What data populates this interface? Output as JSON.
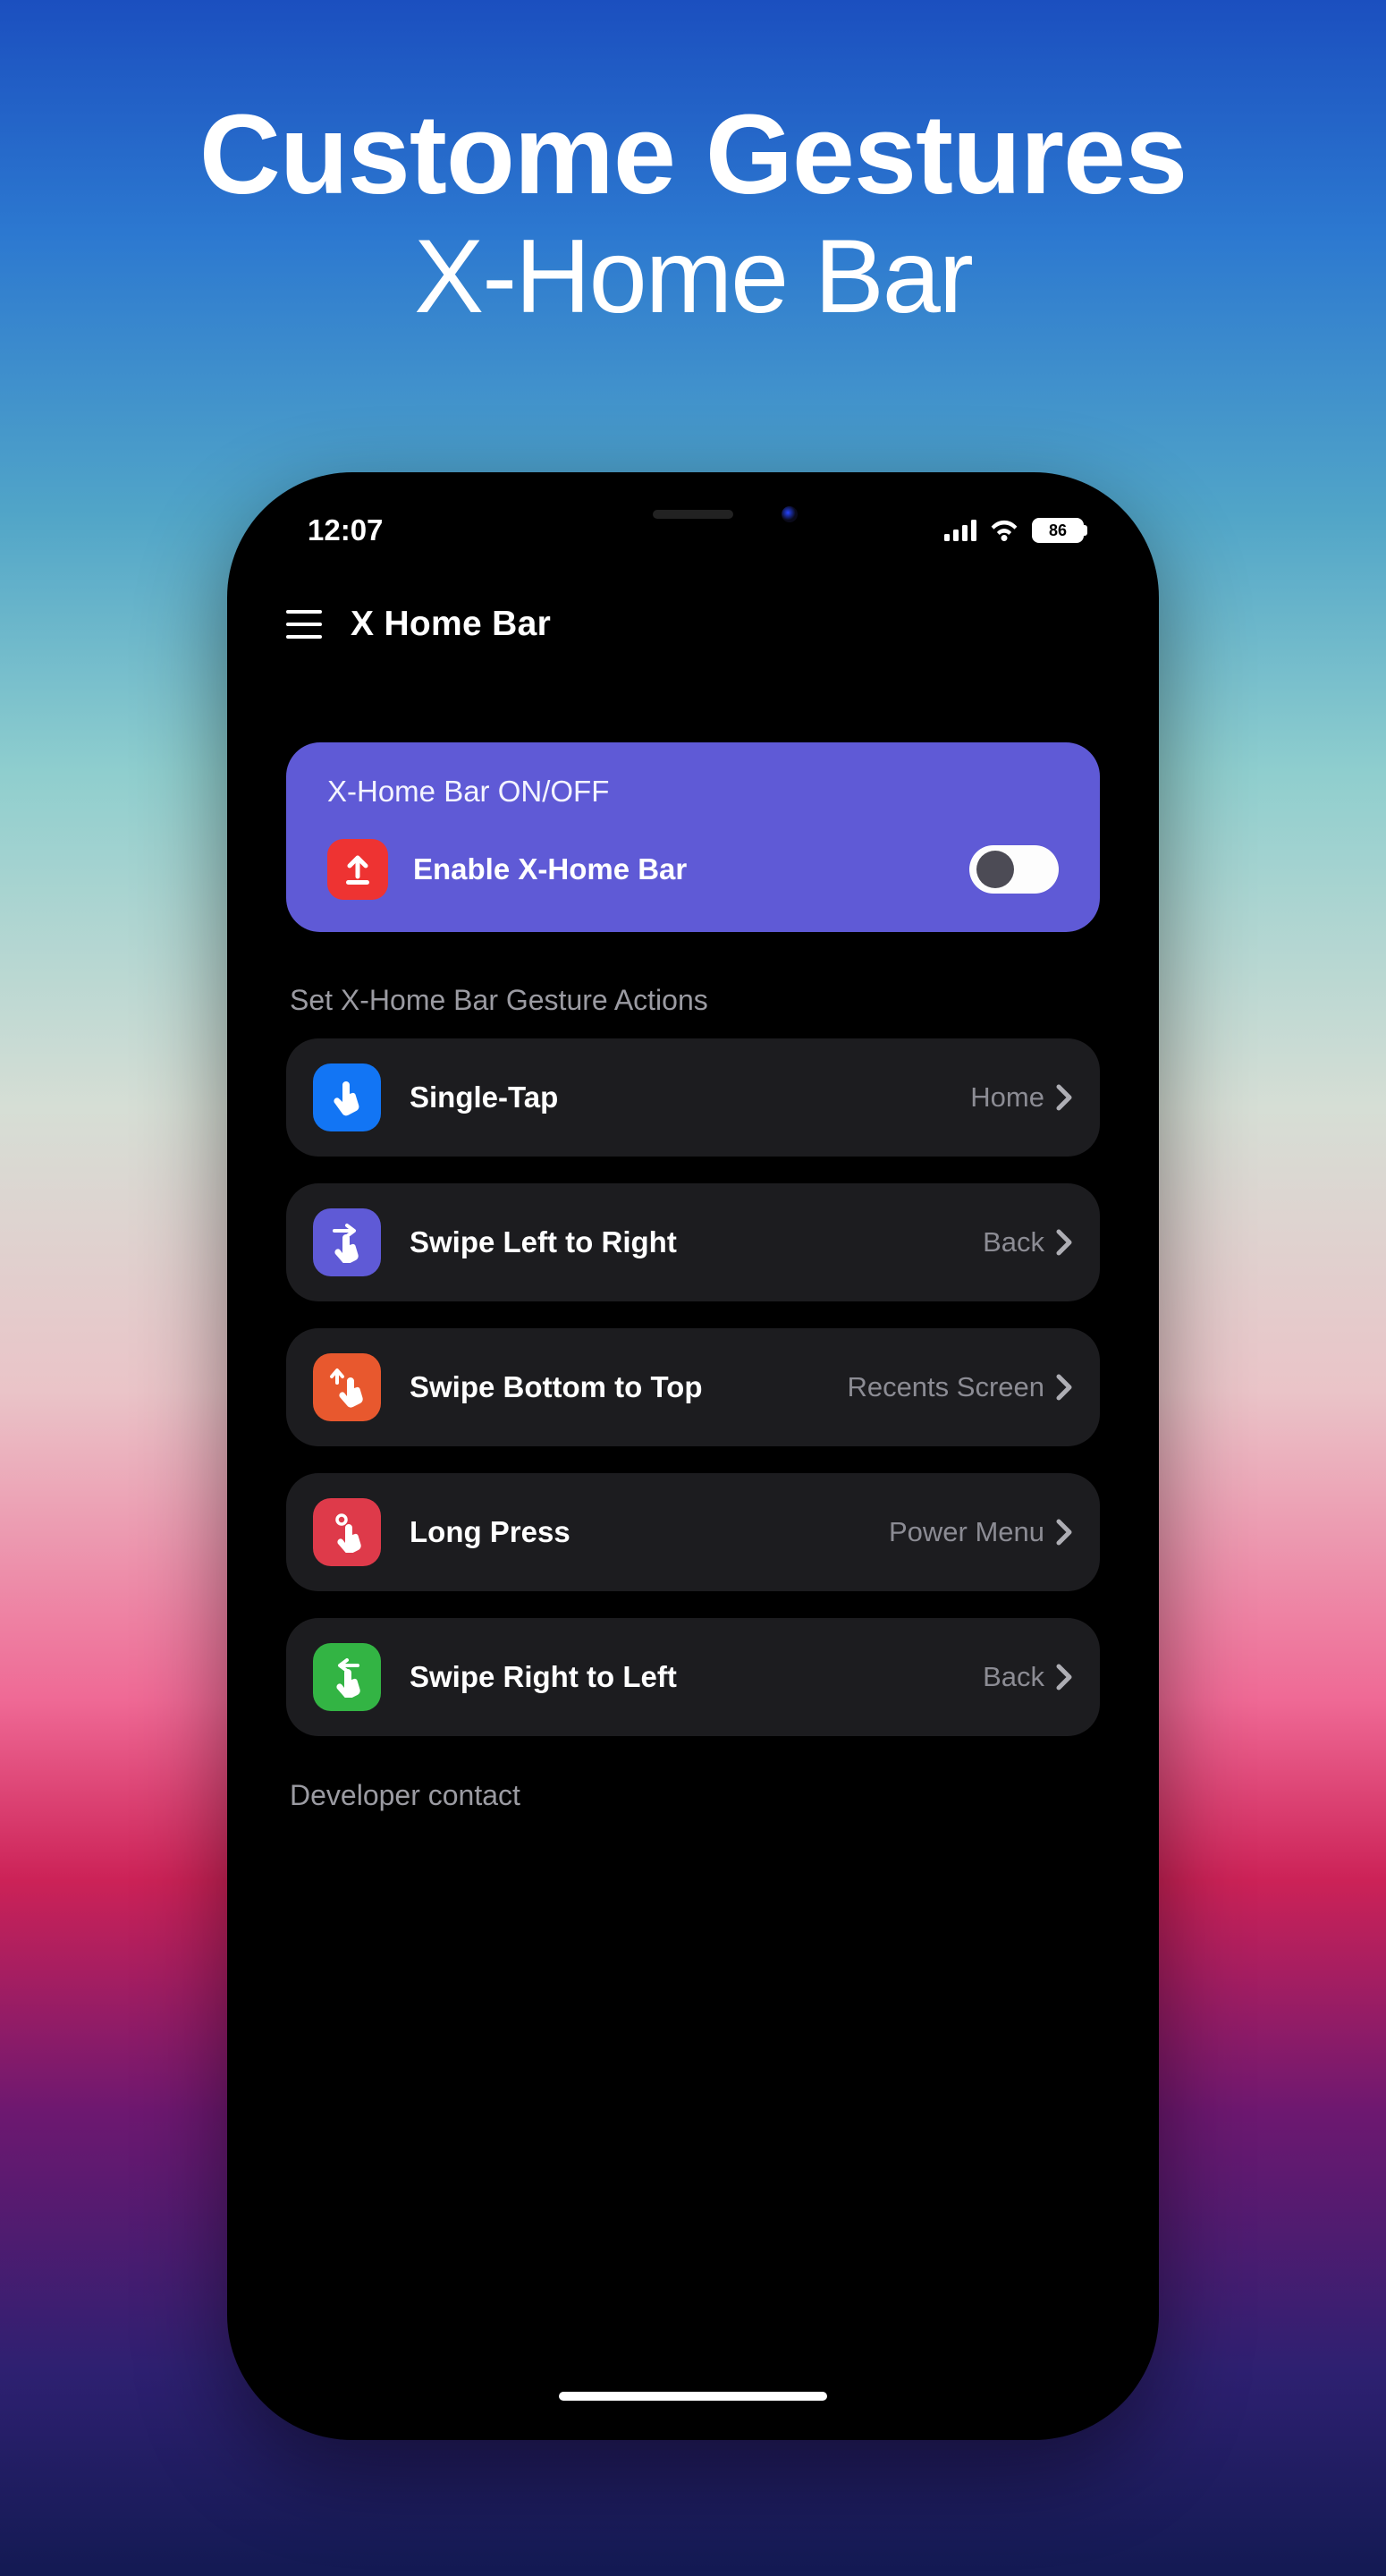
{
  "promo": {
    "line1": "Custome Gestures",
    "line2": "X-Home Bar"
  },
  "status": {
    "time": "12:07",
    "battery": "86"
  },
  "appbar": {
    "title": "X Home Bar"
  },
  "primaryCard": {
    "header": "X-Home Bar ON/OFF",
    "label": "Enable X-Home Bar",
    "toggle": false
  },
  "gesturesSection": {
    "title": "Set X-Home Bar Gesture Actions"
  },
  "gestures": {
    "single_tap": {
      "label": "Single-Tap",
      "value": "Home"
    },
    "swipe_lr": {
      "label": "Swipe Left to Right",
      "value": "Back"
    },
    "swipe_bt": {
      "label": "Swipe Bottom to Top",
      "value": "Recents Screen"
    },
    "long_press": {
      "label": "Long Press",
      "value": "Power Menu"
    },
    "swipe_rl": {
      "label": "Swipe Right to Left",
      "value": "Back"
    }
  },
  "devSection": {
    "title": "Developer contact"
  }
}
